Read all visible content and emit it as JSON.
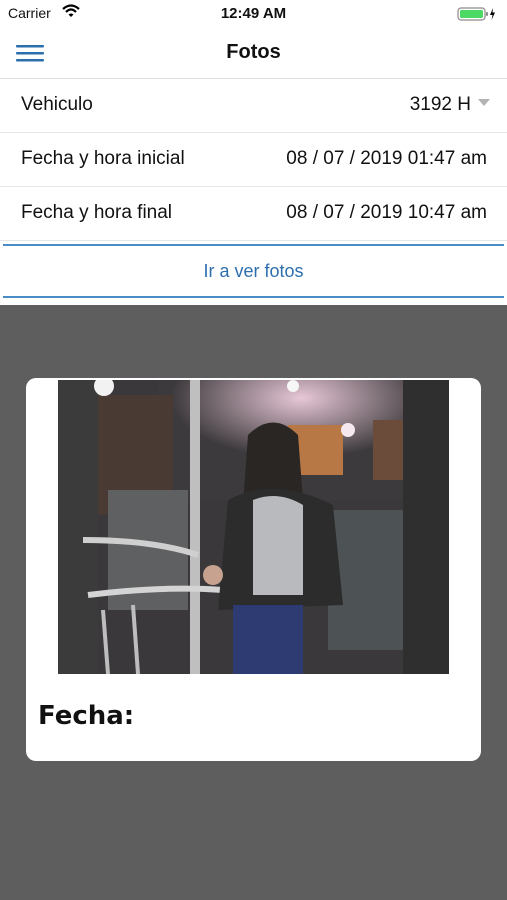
{
  "status_bar": {
    "carrier": "Carrier",
    "time": "12:49 AM"
  },
  "nav": {
    "title": "Fotos",
    "menu_icon": "hamburger-menu-icon"
  },
  "form": {
    "vehicle": {
      "label": "Vehiculo",
      "value": "3192 H"
    },
    "start": {
      "label": "Fecha y hora inicial",
      "value": "08 / 07 / 2019 01:47 am"
    },
    "end": {
      "label": "Fecha y hora final",
      "value": "08 / 07 / 2019 10:47 am"
    }
  },
  "action": {
    "label": "Ir a ver fotos"
  },
  "photo_card": {
    "label": "Fecha:"
  },
  "colors": {
    "accent": "#2d6fae",
    "divider": "#4a8cc7",
    "background": "#5e5e5e"
  }
}
